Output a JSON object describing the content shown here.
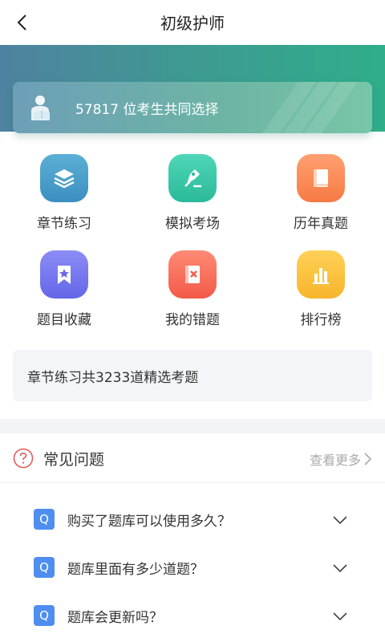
{
  "header": {
    "title": "初级护师"
  },
  "banner": {
    "stat_text": "57817 位考生共同选择"
  },
  "grid": {
    "items": [
      {
        "label": "章节练习",
        "icon": "layers-icon",
        "color_top": "#5bb0d6",
        "color_bottom": "#3b8fc0"
      },
      {
        "label": "模拟考场",
        "icon": "pen-nib-icon",
        "color_top": "#4fd7b7",
        "color_bottom": "#2ab99a"
      },
      {
        "label": "历年真题",
        "icon": "book-icon",
        "color_top": "#ffa070",
        "color_bottom": "#f77a44"
      },
      {
        "label": "题目收藏",
        "icon": "star-bookmark-icon",
        "color_top": "#8c8cf6",
        "color_bottom": "#6466e8"
      },
      {
        "label": "我的错题",
        "icon": "wrong-book-icon",
        "color_top": "#ff8a76",
        "color_bottom": "#f25a48"
      },
      {
        "label": "排行榜",
        "icon": "bar-chart-icon",
        "color_top": "#ffd158",
        "color_bottom": "#f7b52a"
      }
    ]
  },
  "info": {
    "text": "章节练习共3233道精选考题"
  },
  "faq": {
    "title": "常见问题",
    "more_label": "查看更多",
    "badge": "Q",
    "items": [
      {
        "question": "购买了题库可以使用多久？"
      },
      {
        "question": "题库里面有多少道题？"
      },
      {
        "question": "题库会更新吗？"
      }
    ]
  },
  "colors": {
    "accent": "#2fae8a",
    "faq_badge": "#4f8ef0",
    "faq_icon": "#e25c5c"
  }
}
